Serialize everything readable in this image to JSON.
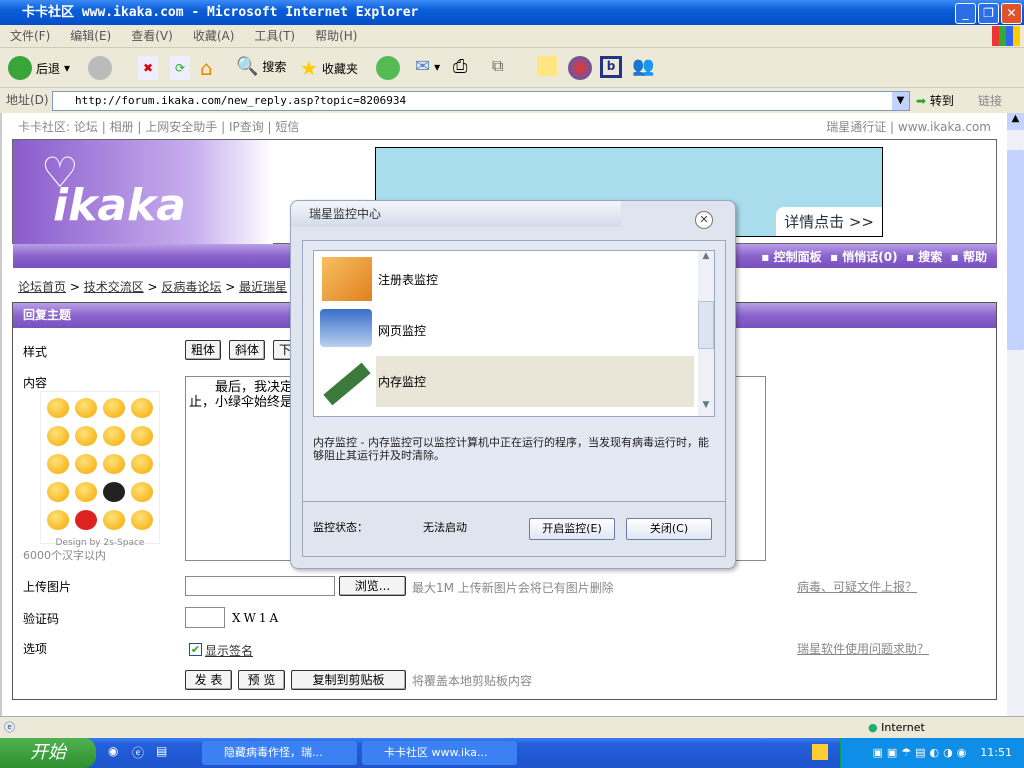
{
  "window": {
    "title": "卡卡社区 www.ikaka.com - Microsoft Internet Explorer"
  },
  "menu": [
    "文件(F)",
    "编辑(E)",
    "查看(V)",
    "收藏(A)",
    "工具(T)",
    "帮助(H)"
  ],
  "toolbar": {
    "back": "后退",
    "search": "搜索",
    "favorites": "收藏夹"
  },
  "address": {
    "label": "地址(D)",
    "url": "http://forum.ikaka.com/new_reply.asp?topic=8206934",
    "go": "转到",
    "links": "链接"
  },
  "page": {
    "toplinks": [
      "卡卡社区:",
      "论坛",
      "相册",
      "上网安全助手",
      "IP查询",
      "短信"
    ],
    "topright": [
      "瑞星通行证",
      "www.ikaka.com"
    ],
    "logo": "ikaka",
    "banner_link": "详情点击 >>",
    "nav": [
      "控制面板",
      "悄悄话(0)",
      "搜索",
      "帮助"
    ],
    "breadcrumb": [
      "论坛首页",
      "技术交流区",
      "反病毒论坛",
      "最近瑞星"
    ],
    "section_title": "回复主题",
    "form": {
      "style_label": "样式",
      "style_buttons": [
        "粗体",
        "斜体",
        "下"
      ],
      "content_label": "内容",
      "content_text": "　　最后，我决定\n止，小绿伞始终是",
      "emoji_credit": "Design by 2s-Space",
      "limit": "6000个汉字以内",
      "upload_label": "上传图片",
      "browse": "浏览...",
      "upload_hint": "最大1M 上传新图片会将已有图片删除",
      "captcha_label": "验证码",
      "captcha": "XW1A",
      "options_label": "选项",
      "show_sig": "显示签名",
      "show_sig_checked": true,
      "submit": "发 表",
      "preview": "预 览",
      "copy": "复制到剪贴板",
      "copy_hint": "将覆盖本地剪贴板内容",
      "report_link": "病毒、可疑文件上报？",
      "help_link": "瑞星软件使用问题求助？"
    }
  },
  "dialog": {
    "title": "瑞星监控中心",
    "items": [
      "注册表监控",
      "网页监控",
      "内存监控"
    ],
    "selected": "内存监控",
    "description": "内存监控 - 内存监控可以监控计算机中正在运行的程序，当发现有病毒运行时，能够阻止其运行并及时清除。",
    "status_label": "监控状态：",
    "status_value": "无法启动",
    "start_button": "开启监控(E)",
    "close_button": "关闭(C)"
  },
  "statusbar": {
    "zone": "Internet"
  },
  "taskbar": {
    "start": "开始",
    "tasks": [
      "隐藏病毒作怪，瑞...",
      "卡卡社区 www.ika..."
    ],
    "clock": "11:51"
  }
}
